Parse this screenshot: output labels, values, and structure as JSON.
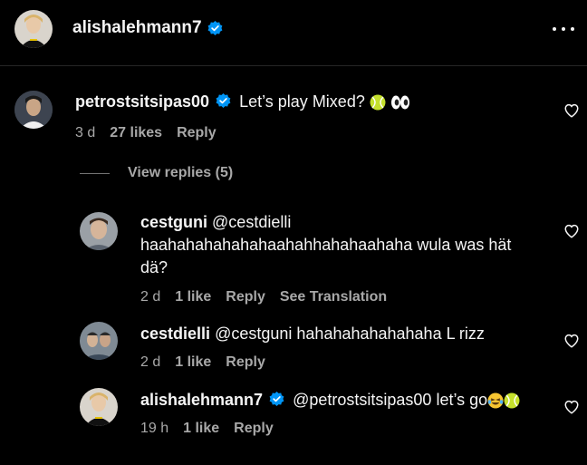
{
  "header": {
    "username": "alishalehmann7"
  },
  "main_comment": {
    "username": "petrostsitsipas00",
    "text": "Let’s play Mixed? ",
    "emoji": [
      "tennis-ball",
      "eyes"
    ],
    "time": "3 d",
    "likes": "27 likes",
    "reply_label": "Reply"
  },
  "view_replies": {
    "label": "View replies (5)"
  },
  "replies": [
    {
      "username": "cestguni",
      "mention": "@cestdielli",
      "text_line1": "haahahahahahahaahahhahahaahaha wula was hät",
      "text_line2": "dä?",
      "time": "2 d",
      "likes": "1 like",
      "reply_label": "Reply",
      "translation_label": "See Translation"
    },
    {
      "username": "cestdielli",
      "mention": "@cestguni",
      "text": "hahahahahahahaha L rizz",
      "time": "2 d",
      "likes": "1 like",
      "reply_label": "Reply"
    },
    {
      "username": "alishalehmann7",
      "mention": "@petrostsitsipas00",
      "text": "let’s go",
      "emoji": [
        "laughing-tears",
        "tennis-ball"
      ],
      "time": "19 h",
      "likes": "1 like",
      "reply_label": "Reply"
    }
  ],
  "colors": {
    "background": "#000000",
    "text": "#f5f5f5",
    "secondary": "#a8a8a8",
    "verified": "#0095f6",
    "divider": "#262626"
  },
  "icons": [
    "verified-badge-icon",
    "more-options-icon",
    "heart-icon",
    "tennis-ball-emoji",
    "eyes-emoji",
    "laughing-tears-emoji"
  ]
}
